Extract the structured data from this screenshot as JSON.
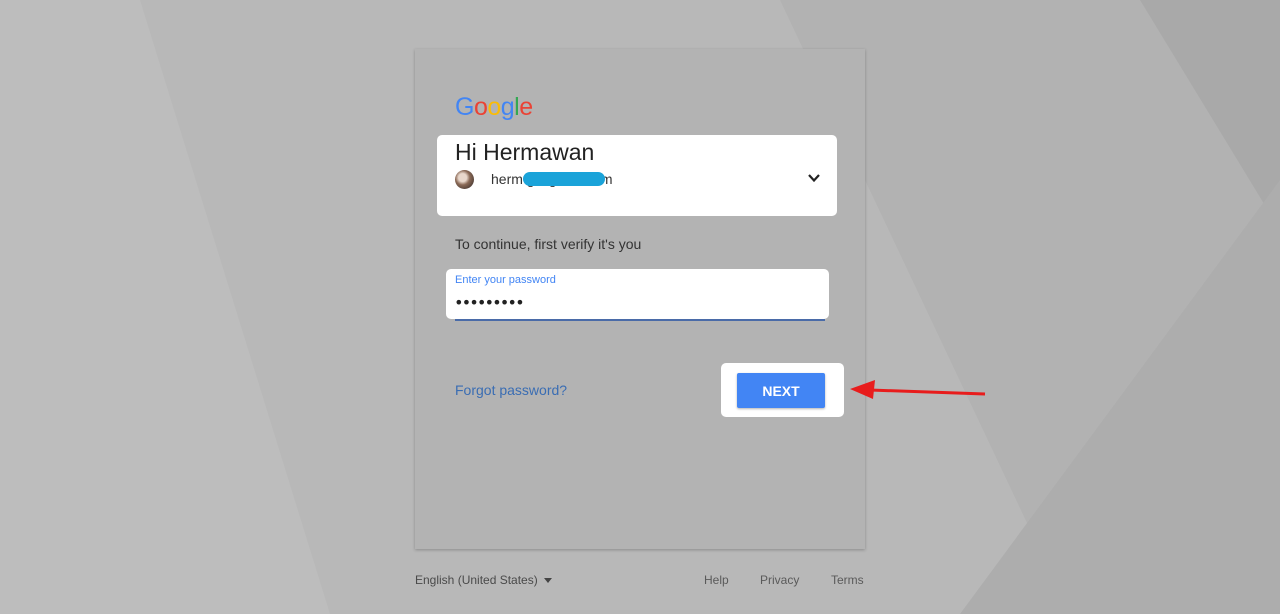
{
  "logo": {
    "letters": [
      "G",
      "o",
      "o",
      "g",
      "l",
      "e"
    ],
    "colors": [
      "#4285f4",
      "#ea4335",
      "#fbbc05",
      "#4285f4",
      "#34a853",
      "#ea4335"
    ]
  },
  "account": {
    "greeting": "Hi Hermawan",
    "email": "herm g@gmail.com",
    "email_redacted": true
  },
  "verify_text": "To continue, first verify it's you",
  "password": {
    "label": "Enter your password",
    "value": "•••••••••"
  },
  "actions": {
    "forgot_label": "Forgot password?",
    "next_label": "NEXT"
  },
  "footer": {
    "language": "English (United States)",
    "links": [
      "Help",
      "Privacy",
      "Terms"
    ]
  },
  "colors": {
    "accent": "#4285f4",
    "annotation_arrow": "#e81c1c",
    "email_redaction": "#1aa3d9"
  }
}
